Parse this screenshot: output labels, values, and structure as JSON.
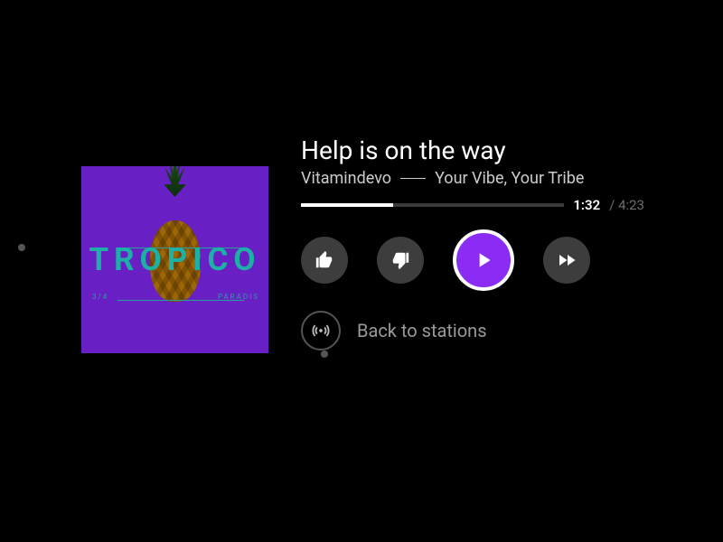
{
  "track": {
    "title": "Help is on the way",
    "artist": "Vitamindevo",
    "station": "Your Vibe, Your Tribe",
    "elapsed": "1:32",
    "total": "4:23",
    "progress_percent": 35
  },
  "album": {
    "main_text": "TROPICO",
    "sub_left": "3/4",
    "sub_right": "PARADIS"
  },
  "actions": {
    "back_label": "Back to stations"
  },
  "colors": {
    "accent": "#8b2cf5",
    "album_bg": "#6820c4"
  }
}
